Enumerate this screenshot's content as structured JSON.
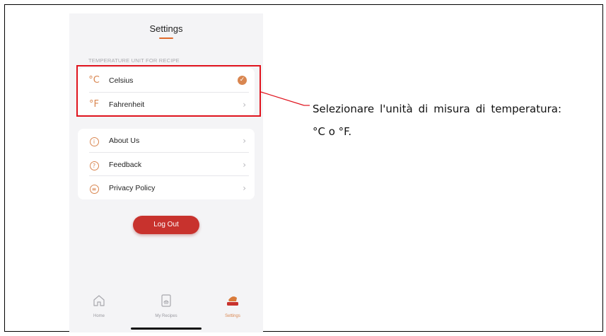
{
  "screen": {
    "title": "Settings",
    "accent_color": "#d98650",
    "highlight_color": "#e0141e"
  },
  "temperature_section": {
    "caption": "TEMPERATURE UNIT FOR RECIPE",
    "options": [
      {
        "symbol": "°C",
        "label": "Celsius",
        "selected": true,
        "indicator": "check-icon"
      },
      {
        "symbol": "°F",
        "label": "Fahrenheit",
        "selected": false,
        "indicator": "chevron-right-icon"
      }
    ]
  },
  "info_section": {
    "items": [
      {
        "icon": "info-icon",
        "label": "About Us"
      },
      {
        "icon": "question-icon",
        "label": "Feedback"
      },
      {
        "icon": "document-icon",
        "label": "Privacy Policy"
      }
    ]
  },
  "logout": {
    "label": "Log Out",
    "color": "#c8322d"
  },
  "tabbar": {
    "tabs": [
      {
        "icon": "home-icon",
        "label": "Home",
        "active": false
      },
      {
        "icon": "recipe-book-icon",
        "label": "My Recipes",
        "active": false
      },
      {
        "icon": "pot-icon",
        "label": "Settings",
        "active": true
      }
    ]
  },
  "annotation": {
    "text": "Selezionare l'unità di misura di temperatura: °C o °F."
  }
}
